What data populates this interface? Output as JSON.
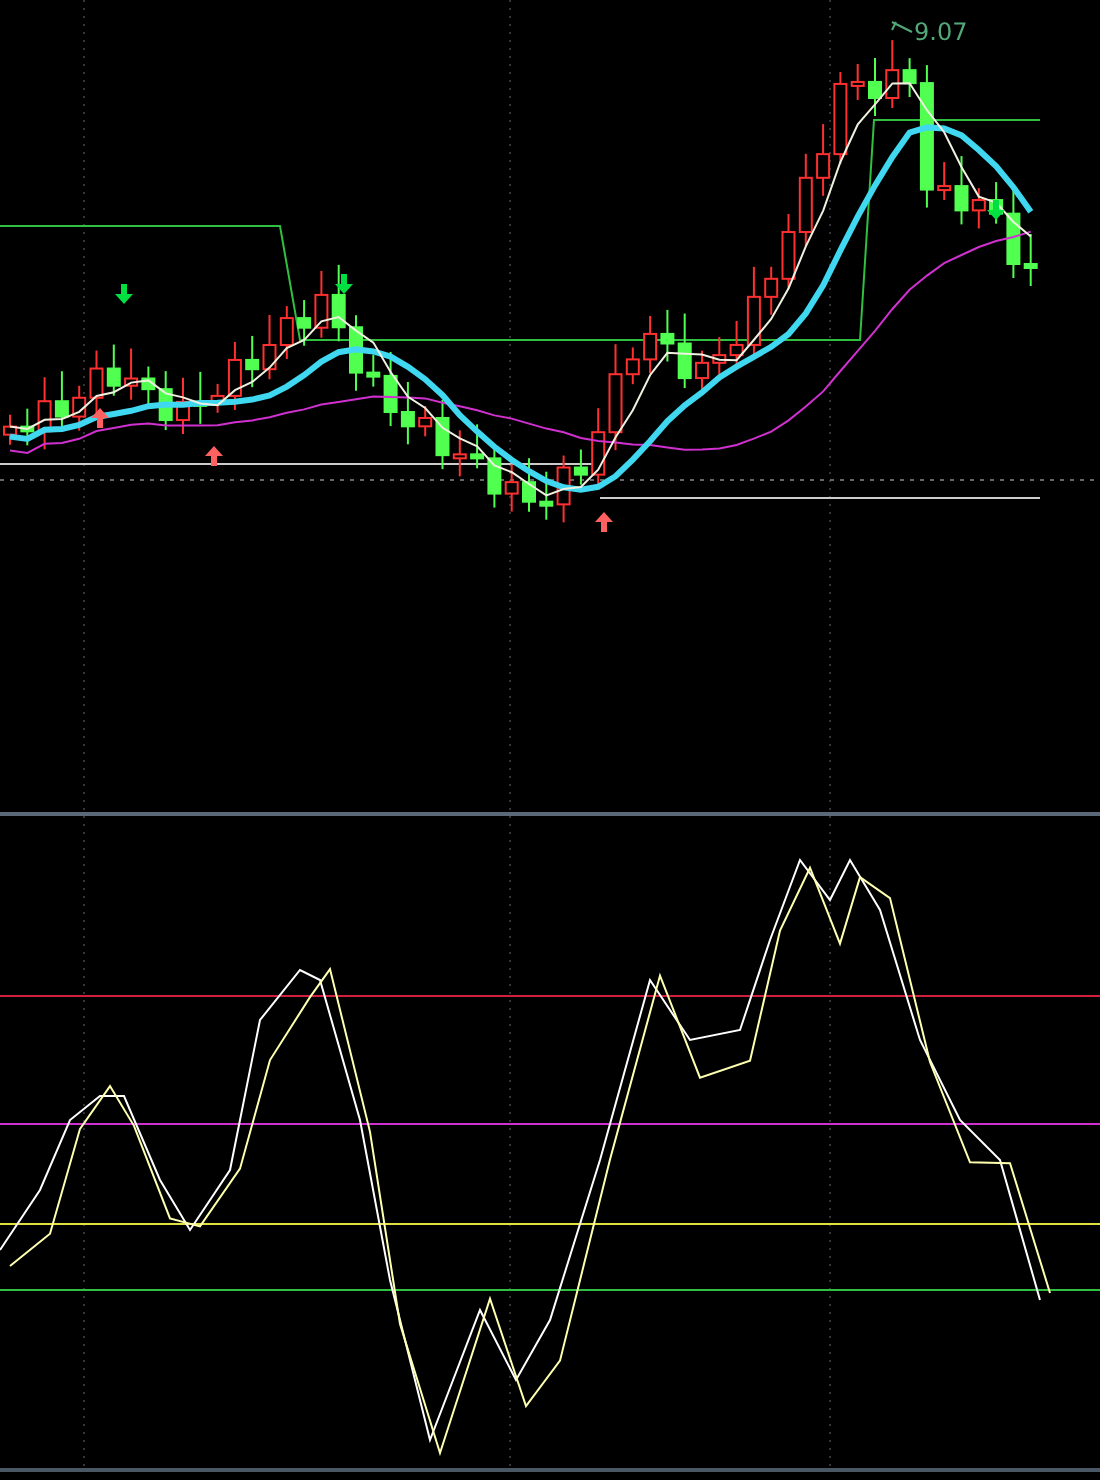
{
  "price_panel": {
    "high_label": "9.07"
  }
}
